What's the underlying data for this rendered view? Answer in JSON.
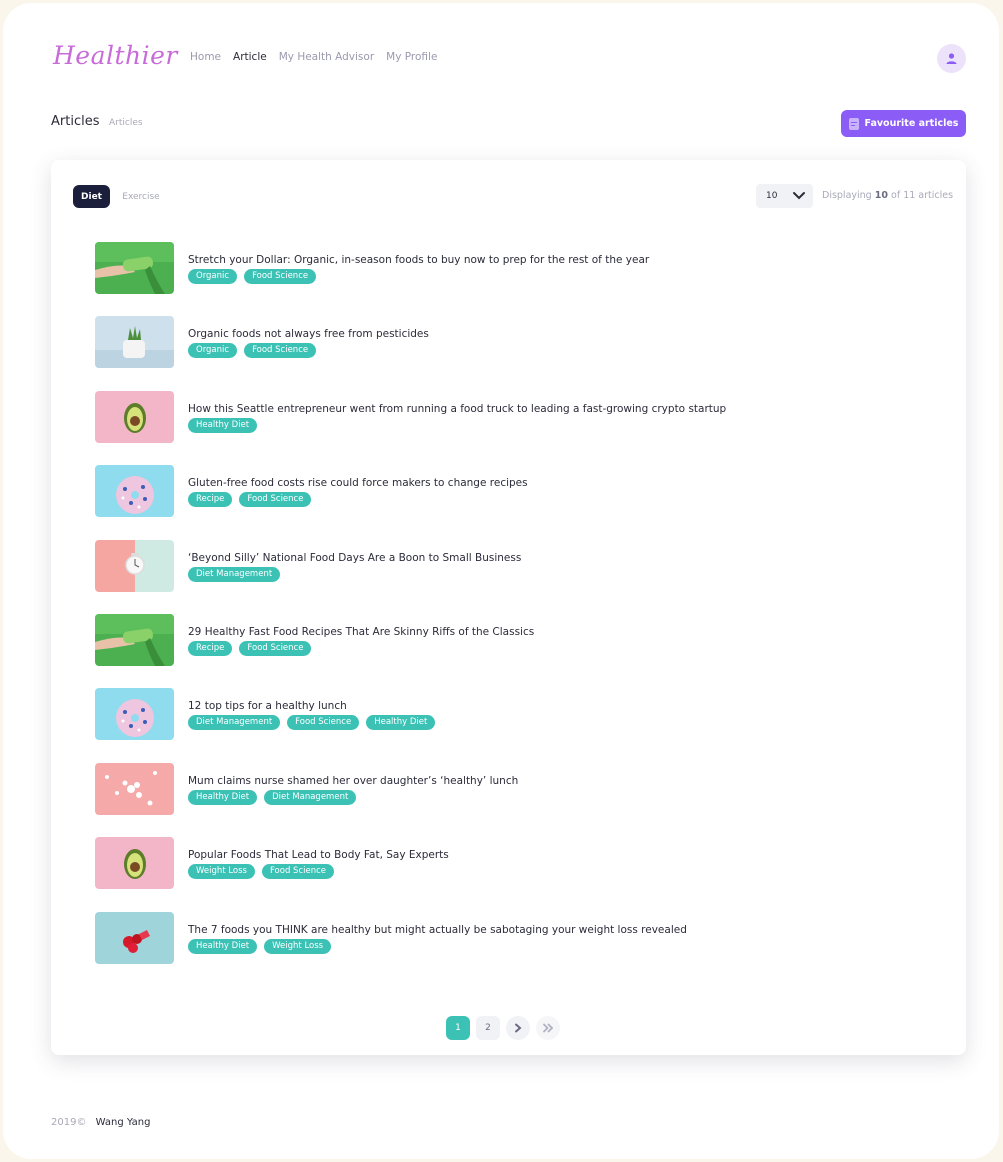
{
  "header": {
    "logo": "Healthier",
    "nav": [
      "Home",
      "Article",
      "My Health Advisor",
      "My Profile"
    ],
    "active_nav": "Article"
  },
  "subheader": {
    "title": "Articles",
    "breadcrumb": "Articles",
    "favourite_button": "Favourite articles"
  },
  "card": {
    "tabs": [
      "Diet",
      "Exercise"
    ],
    "active_tab": "Diet",
    "page_size": "10",
    "display_prefix": "Displaying",
    "display_count": "10",
    "display_suffix": "of 11 articles"
  },
  "articles": [
    {
      "title": "Stretch your Dollar: Organic, in-season foods to buy now to prep for the rest of the year",
      "tags": [
        "Organic",
        "Food Science"
      ],
      "thumb": "green-bottle"
    },
    {
      "title": "Organic foods not always free from pesticides",
      "tags": [
        "Organic",
        "Food Science"
      ],
      "thumb": "plant-pot"
    },
    {
      "title": "How this Seattle entrepreneur went from running a food truck to leading a fast-growing crypto startup",
      "tags": [
        "Healthy Diet"
      ],
      "thumb": "avocado"
    },
    {
      "title": "Gluten-free food costs rise could force makers to change recipes",
      "tags": [
        "Recipe",
        "Food Science"
      ],
      "thumb": "donut"
    },
    {
      "title": "‘Beyond Silly’ National Food Days Are a Boon to Small Business",
      "tags": [
        "Diet Management"
      ],
      "thumb": "clock"
    },
    {
      "title": "29 Healthy Fast Food Recipes That Are Skinny Riffs of the Classics",
      "tags": [
        "Recipe",
        "Food Science"
      ],
      "thumb": "green-bottle"
    },
    {
      "title": "12 top tips for a healthy lunch",
      "tags": [
        "Diet Management",
        "Food Science",
        "Healthy Diet"
      ],
      "thumb": "donut"
    },
    {
      "title": "Mum claims nurse shamed her over daughter’s ‘healthy’ lunch",
      "tags": [
        "Healthy Diet",
        "Diet Management"
      ],
      "thumb": "pills"
    },
    {
      "title": "Popular Foods That Lead to Body Fat, Say Experts",
      "tags": [
        "Weight Loss",
        "Food Science"
      ],
      "thumb": "avocado"
    },
    {
      "title": "The 7 foods you THINK are healthy but might actually be sabotaging your weight loss revealed",
      "tags": [
        "Healthy Diet",
        "Weight Loss"
      ],
      "thumb": "berries"
    }
  ],
  "pagination": {
    "pages": [
      "1",
      "2"
    ],
    "current": "1",
    "next_icon": "chevron-right-icon",
    "last_icon": "double-chevron-right-icon"
  },
  "footer": {
    "year": "2019©",
    "author": "Wang Yang"
  },
  "colors": {
    "accent": "#8b5cf6",
    "tag": "#3cc2b5",
    "dark": "#1b1f3b",
    "logo": "#c86bd9"
  }
}
